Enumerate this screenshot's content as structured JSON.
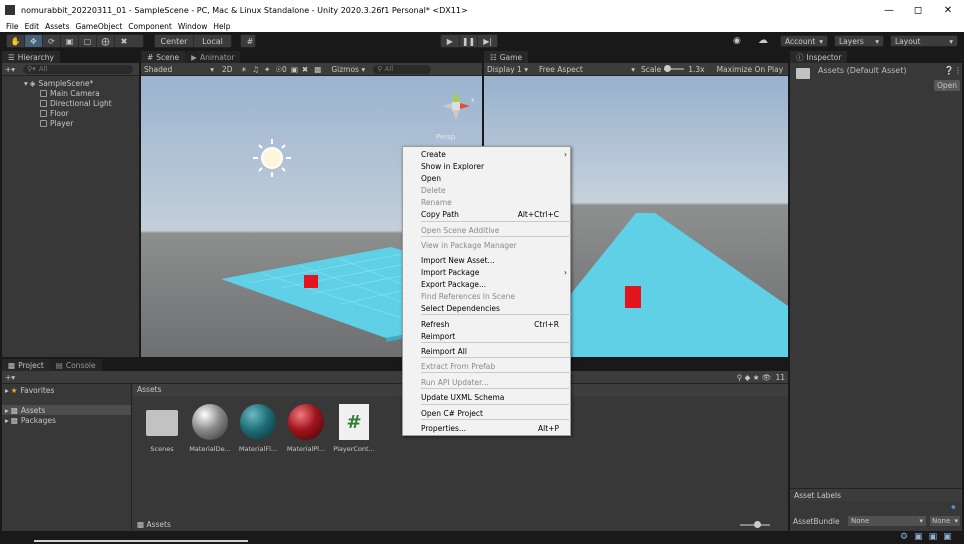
{
  "window": {
    "title": "nomurabbit_20220311_01 - SampleScene - PC, Mac & Linux Standalone - Unity 2020.3.26f1 Personal* <DX11>"
  },
  "menubar": [
    "File",
    "Edit",
    "Assets",
    "GameObject",
    "Component",
    "Window",
    "Help"
  ],
  "toolbar": {
    "center_label": "Center",
    "local_label": "Local",
    "account_label": "Account",
    "layers_label": "Layers",
    "layout_label": "Layout"
  },
  "hierarchy": {
    "tab": "Hierarchy",
    "search_placeholder": "All",
    "scene_name": "SampleScene*",
    "items": [
      "Main Camera",
      "Directional Light",
      "Floor",
      "Player"
    ]
  },
  "scene": {
    "tabs": [
      "Scene",
      "Animator"
    ],
    "shading": "Shaded",
    "mode_2d": "2D",
    "gizmos": "Gizmos",
    "search_placeholder": "All",
    "persp_label": "Persp",
    "gizmo_count": "0"
  },
  "game": {
    "tab": "Game",
    "display": "Display 1",
    "aspect": "Free Aspect",
    "scale_label": "Scale",
    "scale_value": "1.3x",
    "maximize": "Maximize On Play"
  },
  "inspector": {
    "tab": "Inspector",
    "title": "Assets (Default Asset)",
    "open_button": "Open",
    "asset_labels": "Asset Labels",
    "assetbundle_label": "AssetBundle",
    "assetbundle_value": "None",
    "variant_value": "None"
  },
  "project": {
    "tabs": [
      "Project",
      "Console"
    ],
    "favorites": "Favorites",
    "tree": [
      "Assets",
      "Packages"
    ],
    "breadcrumb": "Assets",
    "footer_path": "Assets",
    "hidden_count": "11",
    "assets": [
      {
        "label": "Scenes",
        "kind": "folder"
      },
      {
        "label": "MaterialDe...",
        "kind": "material",
        "color": "#8a8a8a"
      },
      {
        "label": "MaterialFl...",
        "kind": "material",
        "color": "#1e6e78"
      },
      {
        "label": "MaterialPl...",
        "kind": "material",
        "color": "#a0141c"
      },
      {
        "label": "PlayerCont...",
        "kind": "script"
      }
    ]
  },
  "context_menu": {
    "items": [
      {
        "label": "Create",
        "shortcut": "",
        "submenu": true,
        "disabled": false
      },
      {
        "label": "Show in Explorer",
        "shortcut": "",
        "disabled": false
      },
      {
        "label": "Open",
        "shortcut": "",
        "disabled": false
      },
      {
        "label": "Delete",
        "shortcut": "",
        "disabled": true
      },
      {
        "label": "Rename",
        "shortcut": "",
        "disabled": true
      },
      {
        "label": "Copy Path",
        "shortcut": "Alt+Ctrl+C",
        "disabled": false
      },
      {
        "label": "Open Scene Additive",
        "shortcut": "",
        "disabled": true
      },
      {
        "label": "View in Package Manager",
        "shortcut": "",
        "disabled": true
      },
      {
        "label": "Import New Asset...",
        "shortcut": "",
        "disabled": false,
        "highlighted": true
      },
      {
        "label": "Import Package",
        "shortcut": "",
        "submenu": true,
        "disabled": false
      },
      {
        "label": "Export Package...",
        "shortcut": "",
        "disabled": false
      },
      {
        "label": "Find References In Scene",
        "shortcut": "",
        "disabled": true
      },
      {
        "label": "Select Dependencies",
        "shortcut": "",
        "disabled": false
      },
      {
        "label": "Refresh",
        "shortcut": "Ctrl+R",
        "disabled": false
      },
      {
        "label": "Reimport",
        "shortcut": "",
        "disabled": false
      },
      {
        "label": "Reimport All",
        "shortcut": "",
        "disabled": false
      },
      {
        "label": "Extract From Prefab",
        "shortcut": "",
        "disabled": true
      },
      {
        "label": "Run API Updater...",
        "shortcut": "",
        "disabled": true
      },
      {
        "label": "Update UXML Schema",
        "shortcut": "",
        "disabled": false
      },
      {
        "label": "Open C# Project",
        "shortcut": "",
        "disabled": false
      },
      {
        "label": "Properties...",
        "shortcut": "Alt+P",
        "disabled": false
      }
    ]
  },
  "colors": {
    "accent": "#46607c",
    "highlight": "#99c9ef",
    "highlight_border": "#d0021b",
    "floor": "#5fd0e6",
    "cube": "#e3141e"
  }
}
